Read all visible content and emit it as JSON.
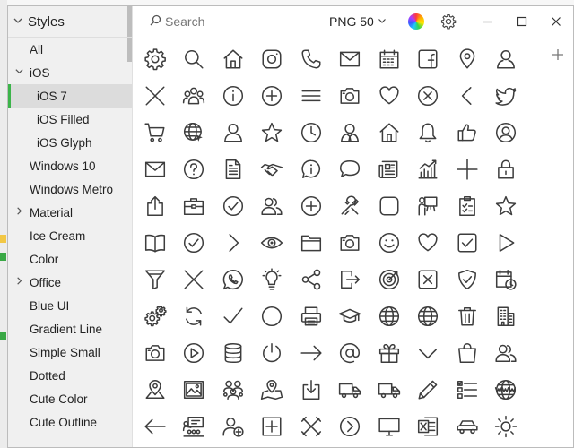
{
  "sidebar": {
    "header": "Styles",
    "items": [
      {
        "label": "All",
        "level": 0,
        "expandable": false,
        "expanded": false
      },
      {
        "label": "iOS",
        "level": 0,
        "expandable": true,
        "expanded": true
      },
      {
        "label": "iOS 7",
        "level": 1,
        "expandable": false,
        "selected": true
      },
      {
        "label": "iOS Filled",
        "level": 1,
        "expandable": false
      },
      {
        "label": "iOS Glyph",
        "level": 1,
        "expandable": false
      },
      {
        "label": "Windows 10",
        "level": 0,
        "expandable": false
      },
      {
        "label": "Windows Metro",
        "level": 0,
        "expandable": false
      },
      {
        "label": "Material",
        "level": 0,
        "expandable": true,
        "expanded": false
      },
      {
        "label": "Ice Cream",
        "level": 0,
        "expandable": false
      },
      {
        "label": "Color",
        "level": 0,
        "expandable": false
      },
      {
        "label": "Office",
        "level": 0,
        "expandable": true,
        "expanded": false
      },
      {
        "label": "Blue UI",
        "level": 0,
        "expandable": false
      },
      {
        "label": "Gradient Line",
        "level": 0,
        "expandable": false
      },
      {
        "label": "Simple Small",
        "level": 0,
        "expandable": false
      },
      {
        "label": "Dotted",
        "level": 0,
        "expandable": false
      },
      {
        "label": "Cute Color",
        "level": 0,
        "expandable": false
      },
      {
        "label": "Cute Outline",
        "level": 0,
        "expandable": false
      }
    ]
  },
  "toolbar": {
    "search_placeholder": "Search",
    "format_label": "PNG 50"
  },
  "colors": {
    "selected_accent": "#3cb44a",
    "icon_stroke": "#3d3d3d"
  },
  "icons": [
    [
      "gear-icon",
      "search-icon",
      "home-icon",
      "instagram-icon",
      "phone-icon",
      "mail-icon",
      "calendar-icon",
      "facebook-icon",
      "location-pin-icon",
      "user-icon"
    ],
    [
      "close-x-icon",
      "group-icon",
      "info-icon",
      "plus-circle-icon",
      "menu-icon",
      "camera-icon",
      "heart-icon",
      "cancel-circle-icon",
      "chevron-left-icon",
      "twitter-icon"
    ],
    [
      "cart-icon",
      "globe-cursor-icon",
      "user-icon",
      "star-icon",
      "clock-icon",
      "user-tie-icon",
      "home-icon",
      "bell-icon",
      "thumbs-up-icon",
      "user-circle-icon"
    ],
    [
      "mail-icon",
      "help-icon",
      "document-icon",
      "handshake-icon",
      "info-bubble-icon",
      "chat-icon",
      "newspaper-icon",
      "bar-chart-icon",
      "plus-icon",
      "lock-icon"
    ],
    [
      "share-icon",
      "briefcase-icon",
      "checkmark-circle-icon",
      "users-icon",
      "plus-circle-icon",
      "tools-icon",
      "rounded-square-icon",
      "presenter-icon",
      "checklist-icon",
      "star-icon"
    ],
    [
      "book-icon",
      "checkmark-circle-icon",
      "chevron-right-icon",
      "eye-icon",
      "folder-icon",
      "camera-icon",
      "smile-icon",
      "heart-icon",
      "checkbox-icon",
      "play-icon"
    ],
    [
      "filter-icon",
      "close-x-icon",
      "whatsapp-icon",
      "bulb-icon",
      "share-nodes-icon",
      "logout-icon",
      "target-icon",
      "close-box-icon",
      "shield-check-icon",
      "calendar-clock-icon"
    ],
    [
      "gears-icon",
      "refresh-icon",
      "checkmark-icon",
      "circle-icon",
      "printer-icon",
      "graduation-cap-icon",
      "globe-icon",
      "globe-icon",
      "trash-icon",
      "building-icon"
    ],
    [
      "camera-icon",
      "play-circle-icon",
      "database-icon",
      "power-icon",
      "arrow-right-icon",
      "at-icon",
      "gift-icon",
      "chevron-down-icon",
      "shopping-bag-icon",
      "users-icon"
    ],
    [
      "map-pin-icon",
      "picture-icon",
      "team-icon",
      "map-location-icon",
      "download-icon",
      "truck-icon",
      "truck-icon",
      "pencil-icon",
      "list-icon",
      "globe-www-icon"
    ],
    [
      "arrow-left-icon",
      "classroom-icon",
      "add-user-icon",
      "plus-box-icon",
      "cross-tools-icon",
      "chevron-right-circle-icon",
      "monitor-icon",
      "excel-icon",
      "car-icon",
      "sun-icon"
    ]
  ]
}
